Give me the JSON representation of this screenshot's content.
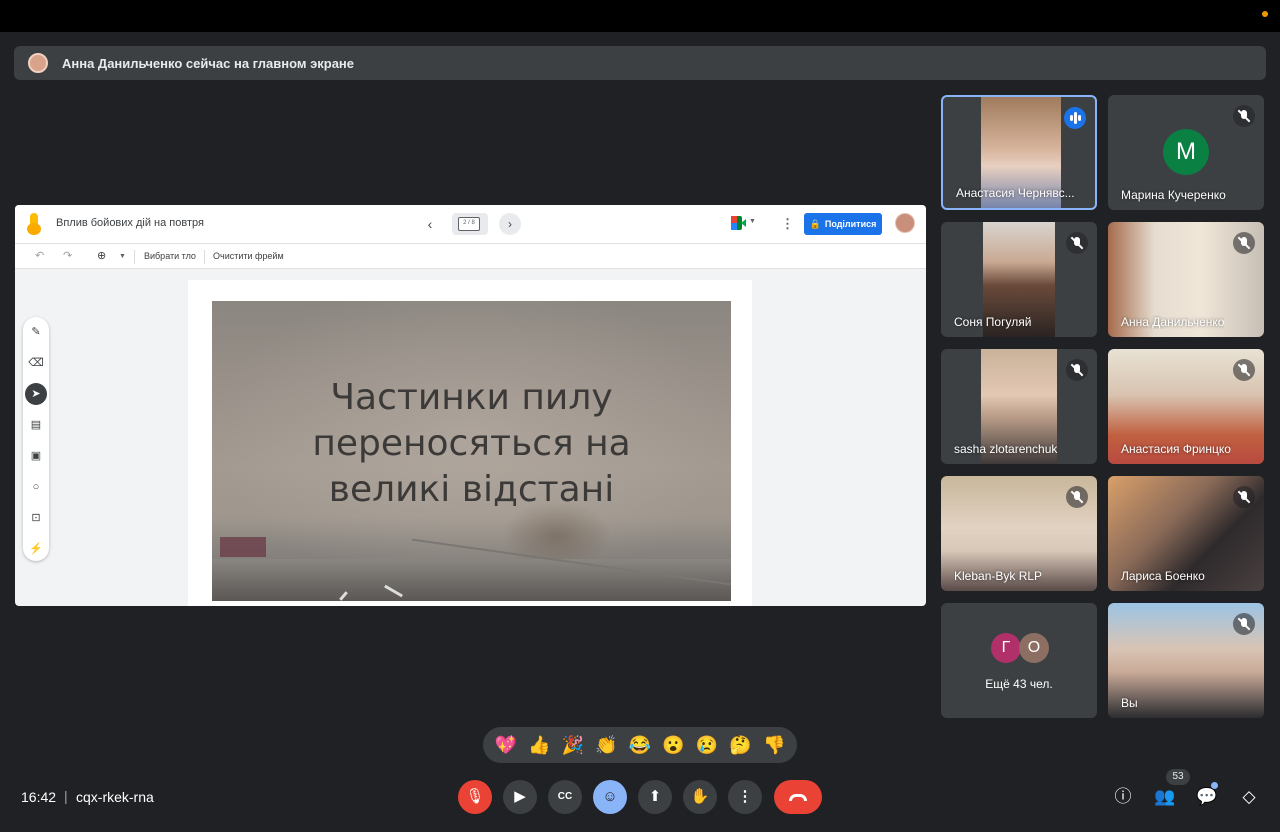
{
  "banner": {
    "text": "Анна Данильченко сейчас на главном экране"
  },
  "presentation": {
    "title": "Вплив бойових дій на повтря",
    "frame_counter": "2 / 8",
    "share_label": "Поділитися",
    "toolbar": {
      "set_background": "Вибрати тло",
      "clear_frame": "Очистити фрейм"
    },
    "slide_text": [
      "Частинки пилу",
      "переносяться на",
      "великі відстані"
    ]
  },
  "participants": [
    {
      "name": "Анастасия Чернявс...",
      "state": "speaking"
    },
    {
      "name": "Марина Кучеренко",
      "state": "muted",
      "avatar_letter": "M",
      "avatar_color": "#0b8043"
    },
    {
      "name": "Соня Погуляй",
      "state": "muted"
    },
    {
      "name": "Анна Данильченко",
      "state": "muted"
    },
    {
      "name": "sasha zlotarenchuk",
      "state": "muted"
    },
    {
      "name": "Анастасия Фринцко",
      "state": "muted"
    },
    {
      "name": "Kleban-Byk RLP",
      "state": "muted"
    },
    {
      "name": "Лариса Боенко",
      "state": "muted"
    },
    {
      "name": "Вы",
      "state": "muted"
    }
  ],
  "more": {
    "label": "Ещё 43 чел.",
    "avatars": [
      {
        "letter": "Г",
        "color": "#b0306a"
      },
      {
        "letter": "О",
        "color": "#8d6e63"
      }
    ]
  },
  "reactions": [
    "💖",
    "👍",
    "🎉",
    "👏",
    "😂",
    "😮",
    "😢",
    "🤔",
    "👎"
  ],
  "footer": {
    "time": "16:42",
    "separator": "|",
    "meeting_code": "cqx-rkek-rna",
    "people_count": "53"
  },
  "colors": {
    "accent": "#8ab4f8",
    "danger": "#ea4335",
    "share_blue": "#1a73e8"
  }
}
